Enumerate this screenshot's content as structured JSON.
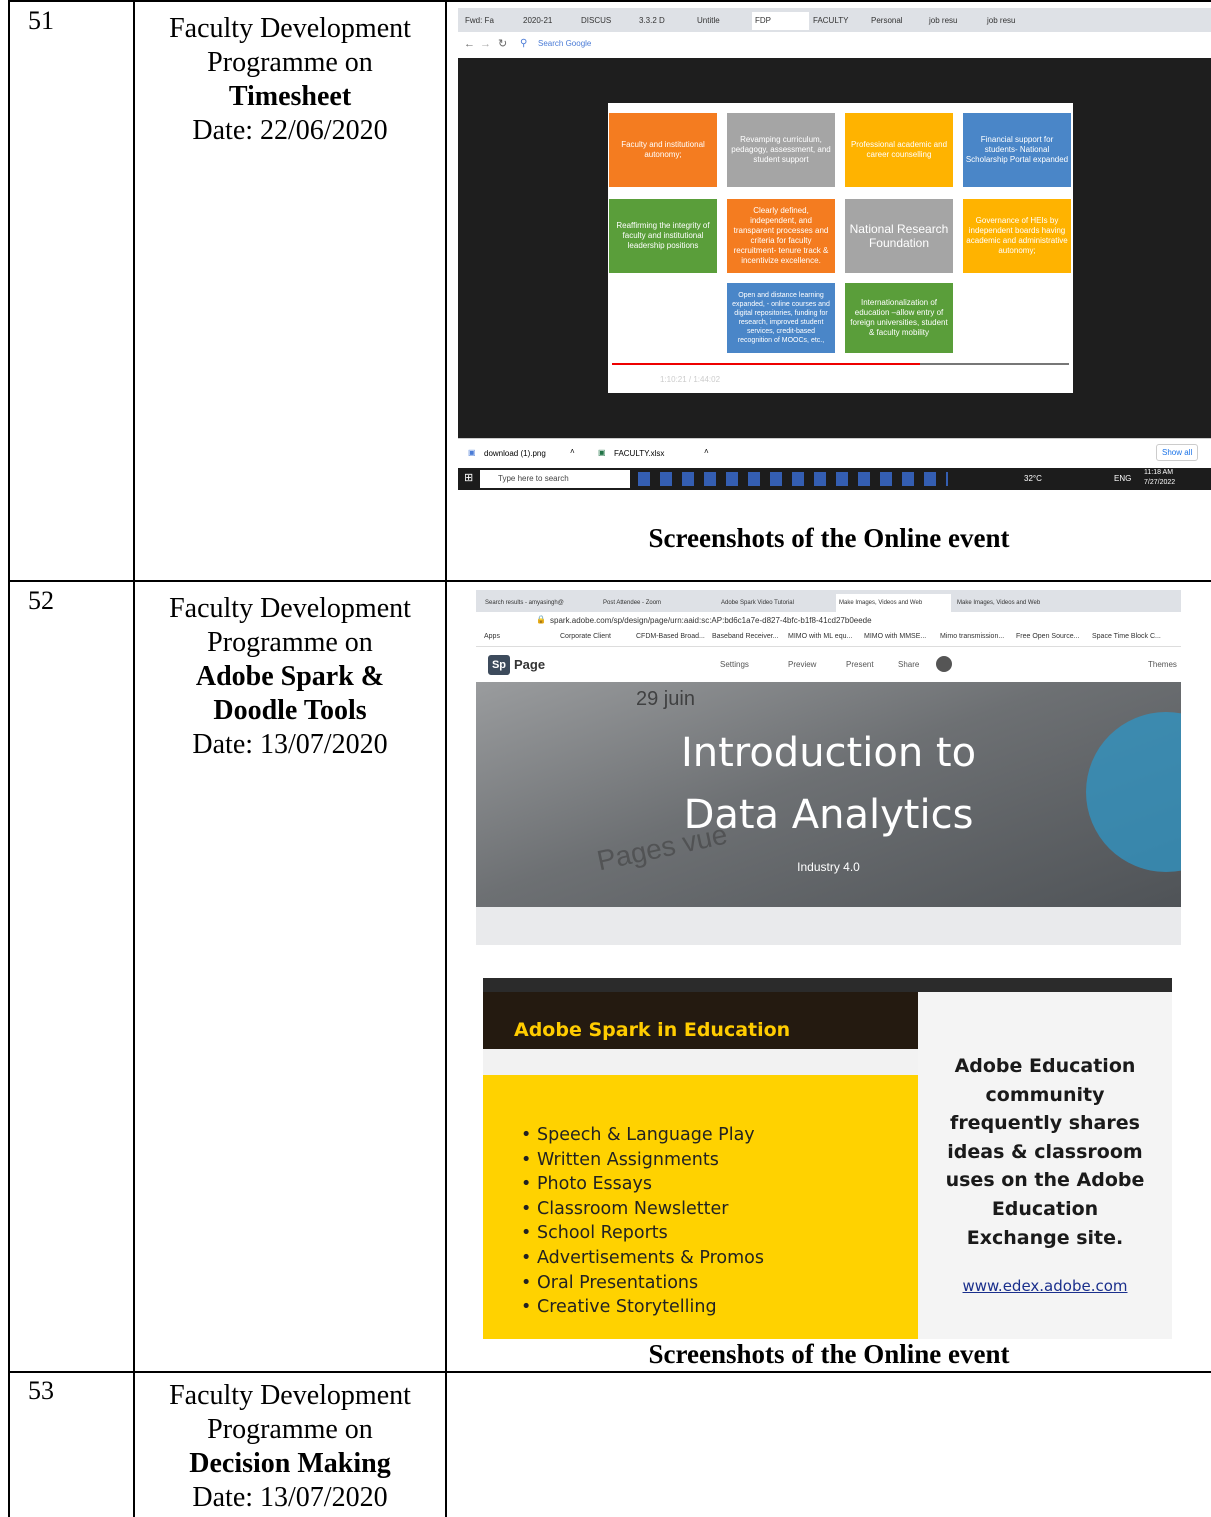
{
  "rows": [
    {
      "number": "51",
      "title_line1": "Faculty Development",
      "title_line2": "Programme on",
      "title_bold": "Timesheet",
      "date": "Date: 22/06/2020",
      "caption": "Screenshots of the Online event"
    },
    {
      "number": "52",
      "title_line1": "Faculty Development",
      "title_line2": "Programme on",
      "title_bold_1": "Adobe Spark &",
      "title_bold_2": "Doodle Tools",
      "date": "Date: 13/07/2020",
      "caption": "Screenshots of the Online event"
    },
    {
      "number": "53",
      "title_line1": "Faculty Development",
      "title_line2": "Programme on",
      "title_bold": "Decision Making",
      "date": "Date: 13/07/2020"
    }
  ],
  "screenshot1": {
    "tabs": [
      "Fwd: Fa",
      "2020-21",
      "DISCUS",
      "3.3.2 D",
      "Untitle",
      "FDP",
      "FACULTY",
      "Personal",
      "job resu",
      "job resu"
    ],
    "address_placeholder": "Search Google",
    "slide_boxes": [
      {
        "text": "Faculty and institutional autonomy;",
        "color": "#f47c20"
      },
      {
        "text": "Revamping curriculum, pedagogy, assessment, and student support",
        "color": "#a5a5a5"
      },
      {
        "text": "Professional academic and career counselling",
        "color": "#ffb300"
      },
      {
        "text": "Financial support for students- National Scholarship Portal expanded",
        "color": "#4a86c8"
      },
      {
        "text": "Reaffirming the integrity of faculty and institutional leadership positions",
        "color": "#5a9e3a"
      },
      {
        "text": "Clearly defined, independent, and transparent processes and criteria for faculty recruitment- tenure track & incentivize excellence.",
        "color": "#f47c20"
      },
      {
        "text": "National Research Foundation",
        "color": "#a5a5a5"
      },
      {
        "text": "Governance of HEIs by independent boards having academic and administrative autonomy;",
        "color": "#ffb300"
      },
      {
        "text": "Open and distance learning expanded, - online courses and digital repositories, funding for research, improved student services, credit-based recognition of MOOCs, etc.,",
        "color": "#4a86c8"
      },
      {
        "text": "Internationalization of education –allow entry of foreign universities, student & faculty mobility",
        "color": "#5a9e3a"
      }
    ],
    "time": "1:10:21 / 1:44:02",
    "downloads": [
      "download (1).png",
      "FACULTY.xlsx"
    ],
    "show_all": "Show all",
    "search_taskbar": "Type here to search",
    "weather": "32°C",
    "lang": "ENG",
    "clock_time": "11:18 AM",
    "clock_date": "7/27/2022"
  },
  "screenshot2": {
    "tabs": [
      "Search results - amyasingh@",
      "Post Attendee - Zoom",
      "Adobe Spark Video Tutorial",
      "Make Images, Videos and Web",
      "Make Images, Videos and Web"
    ],
    "url": "spark.adobe.com/sp/design/page/urn:aaid:sc:AP:bd6c1a7e-d827-4bfc-b1f8-41cd27b0eede",
    "bookmarks": [
      "Apps",
      "Corporate Client",
      "CFDM-Based Broad...",
      "Baseband Receiver...",
      "MIMO with ML equ...",
      "MIMO with MMSE...",
      "Mimo transmission...",
      "Free Open Source...",
      "Space Time Block C..."
    ],
    "brand": "Page",
    "brand_logo": "Sp",
    "toolbar": [
      "Settings",
      "Preview",
      "Present",
      "Share"
    ],
    "themes": "Themes",
    "hero_bg_text1": "29 juin",
    "hero_bg_text2": "Pages vue",
    "hero_title_1": "Introduction to",
    "hero_title_2": "Data Analytics",
    "hero_subtitle": "Industry 4.0"
  },
  "screenshot3": {
    "heading": "Adobe Spark in Education",
    "bullets": [
      "Speech & Language Play",
      "Written Assignments",
      "Photo Essays",
      "Classroom Newsletter",
      "School Reports",
      "Advertisements & Promos",
      "Oral Presentations",
      "Creative Storytelling"
    ],
    "right_text": [
      "Adobe Education",
      "community",
      "frequently shares",
      "ideas & classroom",
      "uses on the Adobe",
      "Education",
      "Exchange site."
    ],
    "link": "www.edex.adobe.com"
  }
}
